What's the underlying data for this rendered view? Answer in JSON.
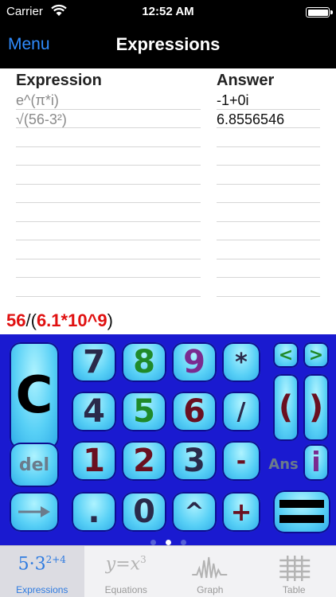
{
  "status_bar": {
    "carrier": "Carrier",
    "time": "12:52 AM"
  },
  "navbar": {
    "menu_label": "Menu",
    "title": "Expressions"
  },
  "table": {
    "headers": {
      "expression": "Expression",
      "answer": "Answer"
    },
    "rows": [
      {
        "expression": "e^(π*i)",
        "answer": "-1+0i"
      },
      {
        "expression": "√(56-3²)",
        "answer": "6.8556546"
      }
    ]
  },
  "input_line": {
    "part1": "56",
    "part2": "/(",
    "part3": "6.1*10^9",
    "part4": ")"
  },
  "keypad": {
    "clear": "C",
    "del": "del",
    "ans": "Ans",
    "info": "i",
    "digits": {
      "d7": "7",
      "d8": "8",
      "d9": "9",
      "d4": "4",
      "d5": "5",
      "d6": "6",
      "d1": "1",
      "d2": "2",
      "d3": "3",
      "d0": "0",
      "dot": "."
    },
    "ops": {
      "multiply": "*",
      "divide": "/",
      "minus": "-",
      "power": "^",
      "plus": "+",
      "left": "<",
      "right": ">",
      "open_paren": "(",
      "close_paren": ")"
    },
    "page_count": 3,
    "active_page": 2
  },
  "tabbar": {
    "tabs": [
      {
        "id": "expressions",
        "label": "Expressions",
        "icon_text": "5·3",
        "icon_sup": "2+4",
        "active": true
      },
      {
        "id": "equations",
        "label": "Equations",
        "icon_text": "y=x",
        "icon_sup": "3",
        "active": false
      },
      {
        "id": "graph",
        "label": "Graph",
        "active": false
      },
      {
        "id": "table",
        "label": "Table",
        "active": false
      }
    ]
  }
}
